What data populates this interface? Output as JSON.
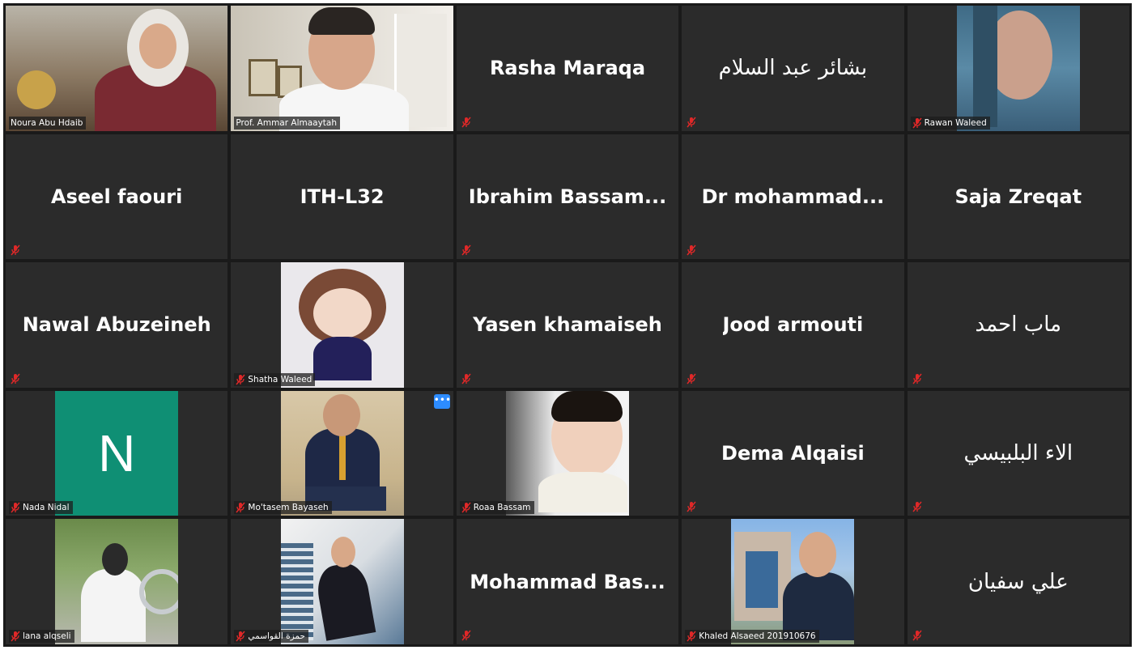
{
  "participants": [
    {
      "name": "Noura Abu Hdaib",
      "display": "video",
      "muted": true
    },
    {
      "name": "Prof. Ammar Almaaytah",
      "display": "video",
      "muted": false
    },
    {
      "name": "Rasha Maraqa",
      "display": "name",
      "muted": true
    },
    {
      "name": "بشائر عبد السلام",
      "display": "name",
      "muted": true
    },
    {
      "name": "Rawan Waleed",
      "display": "photo",
      "muted": true
    },
    {
      "name": "Aseel faouri",
      "display": "name",
      "muted": true
    },
    {
      "name": "ITH-L32",
      "display": "name",
      "muted": false
    },
    {
      "name": "Ibrahim  Bassam...",
      "display": "name",
      "muted": true
    },
    {
      "name": "Dr  mohammad...",
      "display": "name",
      "muted": true
    },
    {
      "name": "Saja Zreqat",
      "display": "name",
      "muted": false
    },
    {
      "name": "Nawal Abuzeineh",
      "display": "name",
      "muted": true
    },
    {
      "name": "Shatha Waleed",
      "display": "photo",
      "muted": true
    },
    {
      "name": "Yasen khamaiseh",
      "display": "name",
      "muted": true
    },
    {
      "name": "Jood armouti",
      "display": "name",
      "muted": true
    },
    {
      "name": "ماب احمد",
      "display": "name",
      "muted": true
    },
    {
      "name": "Nada Nidal",
      "display": "avatar",
      "avatar_letter": "N",
      "muted": true
    },
    {
      "name": "Mo'tasem Bayaseh",
      "display": "photo",
      "muted": true
    },
    {
      "name": "Roaa Bassam",
      "display": "photo",
      "muted": true
    },
    {
      "name": "Dema Alqaisi",
      "display": "name",
      "muted": true
    },
    {
      "name": "الاء البلبيسي",
      "display": "name",
      "muted": true
    },
    {
      "name": "lana alqseli",
      "display": "photo",
      "muted": true
    },
    {
      "name": "حمزة القواسمي",
      "display": "photo",
      "muted": true
    },
    {
      "name": "Mohammad  Bas...",
      "display": "name",
      "muted": true
    },
    {
      "name": "Khaled Alsaeed 201910676",
      "display": "photo",
      "muted": true
    },
    {
      "name": "علي سفيان",
      "display": "name",
      "muted": true
    }
  ],
  "more_button_icon": "ellipsis-icon",
  "more_button_label": "•••",
  "colors": {
    "tile_bg": "#2b2b2b",
    "grid_bg": "#1a1a1a",
    "active_speaker_border": "#c7d94a",
    "muted_icon": "#e02828",
    "avatar_bg": "#0f8f74"
  }
}
